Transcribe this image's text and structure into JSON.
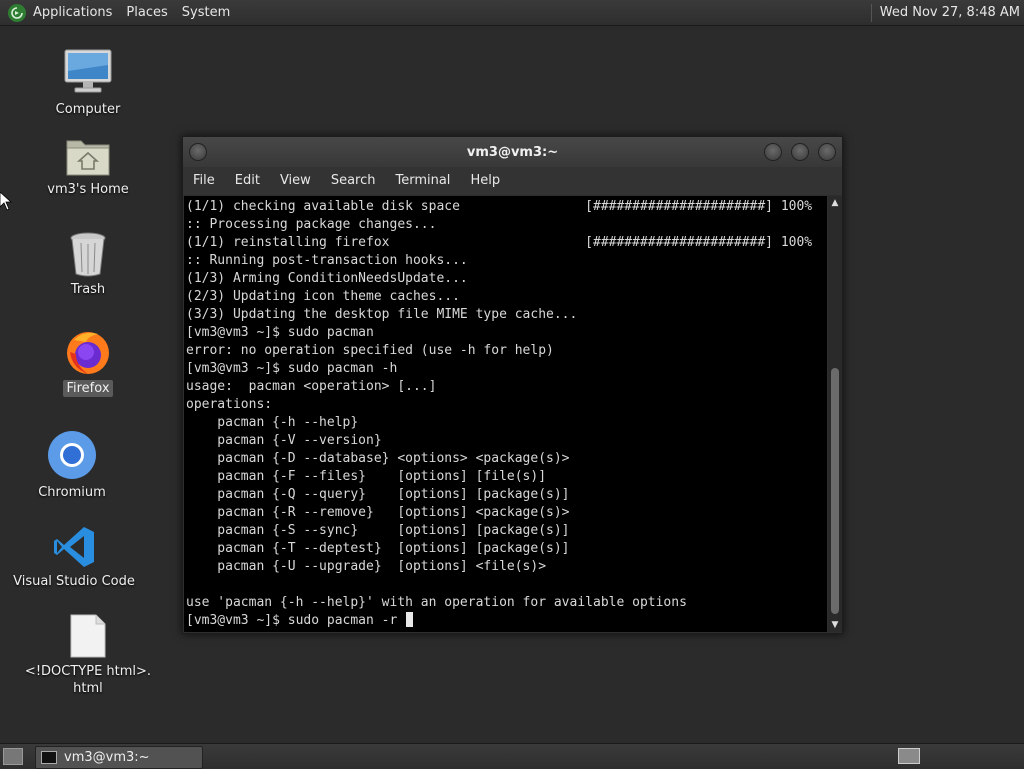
{
  "top_panel": {
    "menus": [
      "Applications",
      "Places",
      "System"
    ],
    "clock": "Wed Nov 27,  8:48 AM"
  },
  "desktop": {
    "icons": [
      {
        "label": "Computer",
        "icon": "computer-icon"
      },
      {
        "label": "vm3's Home",
        "icon": "home-folder-icon"
      },
      {
        "label": "Trash",
        "icon": "trash-icon"
      },
      {
        "label": "Firefox",
        "icon": "firefox-icon"
      },
      {
        "label": "Chromium",
        "icon": "chromium-icon"
      },
      {
        "label": "Visual Studio Code",
        "icon": "vscode-icon"
      },
      {
        "label": "<!DOCTYPE html>.\nhtml",
        "icon": "document-icon"
      }
    ]
  },
  "terminal": {
    "title": "vm3@vm3:~",
    "menu": [
      "File",
      "Edit",
      "View",
      "Search",
      "Terminal",
      "Help"
    ],
    "lines": [
      "(1/1) checking available disk space                [######################] 100%",
      ":: Processing package changes...",
      "(1/1) reinstalling firefox                         [######################] 100%",
      ":: Running post-transaction hooks...",
      "(1/3) Arming ConditionNeedsUpdate...",
      "(2/3) Updating icon theme caches...",
      "(3/3) Updating the desktop file MIME type cache...",
      "[vm3@vm3 ~]$ sudo pacman",
      "error: no operation specified (use -h for help)",
      "[vm3@vm3 ~]$ sudo pacman -h",
      "usage:  pacman <operation> [...]",
      "operations:",
      "    pacman {-h --help}",
      "    pacman {-V --version}",
      "    pacman {-D --database} <options> <package(s)>",
      "    pacman {-F --files}    [options] [file(s)]",
      "    pacman {-Q --query}    [options] [package(s)]",
      "    pacman {-R --remove}   [options] <package(s)>",
      "    pacman {-S --sync}     [options] [package(s)]",
      "    pacman {-T --deptest}  [options] [package(s)]",
      "    pacman {-U --upgrade}  [options] <file(s)>",
      "",
      "use 'pacman {-h --help}' with an operation for available options"
    ],
    "prompt": "[vm3@vm3 ~]$ sudo pacman -r "
  },
  "taskbar": {
    "task_label": "vm3@vm3:~"
  },
  "colors": {
    "terminal_bg": "#000000",
    "terminal_fg": "#d8d8d8",
    "panel_bg": "#333333",
    "desktop_bg": "#2b2b2b"
  }
}
